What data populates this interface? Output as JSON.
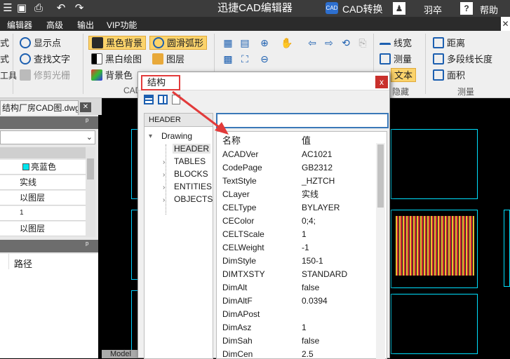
{
  "titlebar": {
    "title": "迅捷CAD编辑器",
    "cad_convert": "CAD转换",
    "cad_logo": "CAD",
    "user": "羽卒",
    "help": "帮助"
  },
  "menu": {
    "items": [
      "编辑器",
      "高级",
      "输出",
      "VIP功能"
    ]
  },
  "ribbon": {
    "left_cut": [
      "式",
      "式",
      "工具"
    ],
    "col1": [
      "显示点",
      "查找文字",
      "修剪光栅"
    ],
    "col2": [
      "黑色背景",
      "黑白绘图",
      "背景色"
    ],
    "col3": [
      "圆滑弧形",
      "图层"
    ],
    "group_cad": "CAD",
    "col_right": [
      "线宽",
      "测量",
      "文本"
    ],
    "col_right2": [
      "距离",
      "多段线长度",
      "面积"
    ],
    "group_hide": "隐藏",
    "group_measure": "测量"
  },
  "file_tab": {
    "label": "结构厂房CAD图.dwg",
    "close": "✕"
  },
  "left_panel": {
    "pin": "ᵖ",
    "rows": [
      "亮蓝色",
      "实线",
      "以图层",
      "1",
      "以图层"
    ],
    "path_label": "路径"
  },
  "dialog": {
    "title": "结构",
    "close": "x",
    "tree_header": "HEADER",
    "tree_root": "Drawing",
    "tree_items": [
      "HEADER",
      "TABLES",
      "BLOCKS",
      "ENTITIES",
      "OBJECTS"
    ],
    "col_name": "名称",
    "col_value": "值",
    "rows": [
      {
        "k": "ACADVer",
        "v": "AC1021"
      },
      {
        "k": "CodePage",
        "v": "GB2312"
      },
      {
        "k": "TextStyle",
        "v": "_HZTCH"
      },
      {
        "k": "CLayer",
        "v": "实线"
      },
      {
        "k": "CELType",
        "v": "BYLAYER"
      },
      {
        "k": "CEColor",
        "v": "0;4;"
      },
      {
        "k": "CELTScale",
        "v": "1"
      },
      {
        "k": "CELWeight",
        "v": "-1"
      },
      {
        "k": "DimStyle",
        "v": "150-1"
      },
      {
        "k": "DIMTXSTY",
        "v": "STANDARD"
      },
      {
        "k": "DimAlt",
        "v": "false"
      },
      {
        "k": "DimAltF",
        "v": "0.0394"
      },
      {
        "k": "DimAPost",
        "v": ""
      },
      {
        "k": "DimAsz",
        "v": "1"
      },
      {
        "k": "DimSah",
        "v": "false"
      },
      {
        "k": "DimCen",
        "v": "2.5"
      }
    ]
  },
  "model_tab": "Model",
  "colors": {
    "accent_red": "#e23b3b",
    "highlight": "#fbd36b",
    "cad_blue": "#1c5fb0"
  }
}
